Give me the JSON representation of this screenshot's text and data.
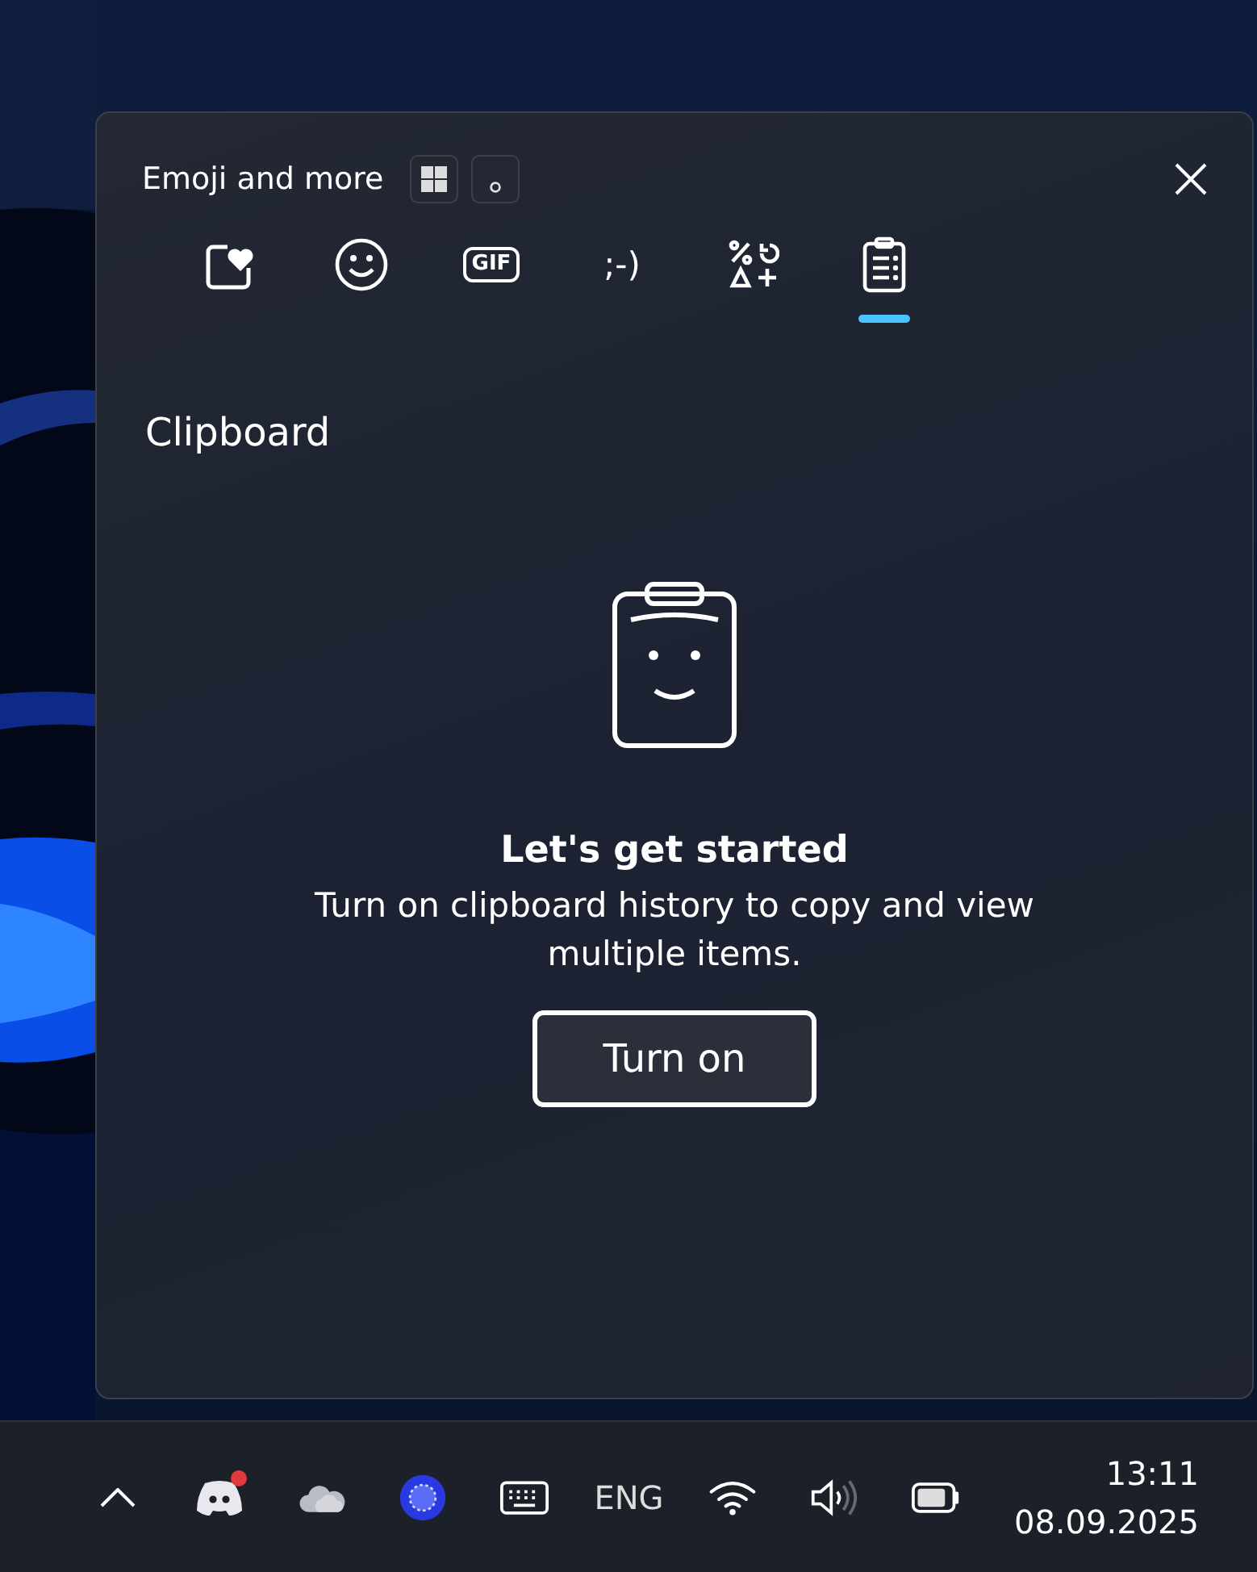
{
  "panel": {
    "title": "Emoji and more",
    "title_buttons": [
      {
        "kind": "windows"
      },
      {
        "kind": "dot"
      }
    ],
    "tabs": [
      {
        "kind": "favorites",
        "selected": false
      },
      {
        "kind": "emoji",
        "selected": false
      },
      {
        "kind": "gif",
        "label": "GIF",
        "selected": false
      },
      {
        "kind": "kaomoji",
        "label": ";-)",
        "selected": false
      },
      {
        "kind": "symbols",
        "selected": false
      },
      {
        "kind": "clipboard",
        "selected": true
      }
    ],
    "section_title": "Clipboard",
    "empty_state": {
      "heading": "Let's get started",
      "message": "Turn on clipboard history to copy and view multiple items.",
      "button": "Turn on"
    }
  },
  "taskbar": {
    "tray": [
      {
        "kind": "chevron"
      },
      {
        "kind": "discord",
        "badge": true
      },
      {
        "kind": "cloud"
      },
      {
        "kind": "app"
      },
      {
        "kind": "keyboard"
      },
      {
        "kind": "language",
        "label": "ENG"
      },
      {
        "kind": "wifi"
      },
      {
        "kind": "volume"
      },
      {
        "kind": "battery"
      }
    ],
    "time": "13:11",
    "date": "08.09.2025"
  }
}
